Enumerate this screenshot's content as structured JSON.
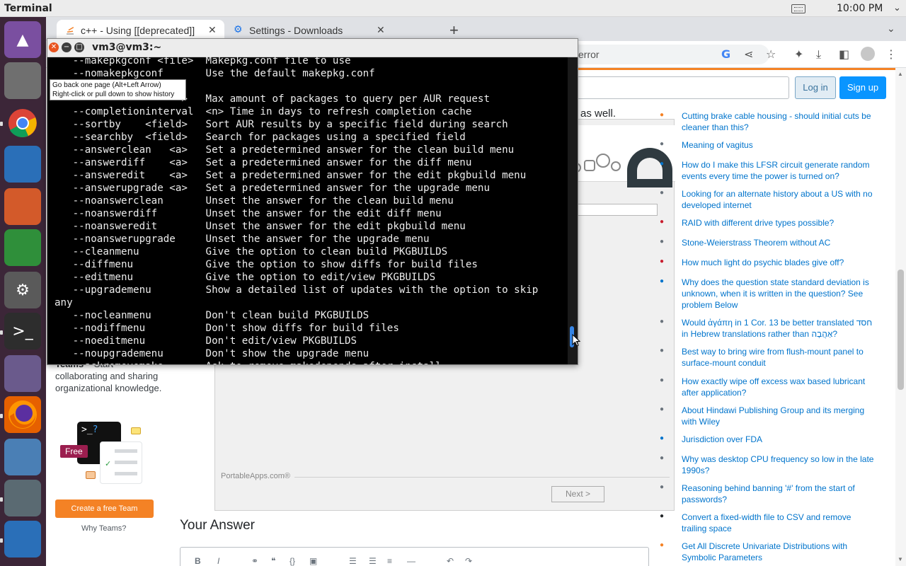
{
  "topbar": {
    "app_name": "Terminal",
    "time": "10:00 PM"
  },
  "dock": {
    "items": [
      {
        "name": "arch-launcher-icon",
        "glyph": "▲",
        "color": "#7a4fa0"
      },
      {
        "name": "files-icon",
        "glyph": "",
        "color": "#6f6f6f"
      },
      {
        "name": "chrome-icon",
        "glyph": "",
        "color": "#3c2638"
      },
      {
        "name": "writer-icon",
        "glyph": "",
        "color": "#2a6fb8"
      },
      {
        "name": "impress-icon",
        "glyph": "",
        "color": "#d35a2a"
      },
      {
        "name": "calc-icon",
        "glyph": "",
        "color": "#2f8f3a"
      },
      {
        "name": "settings-icon",
        "glyph": "⚙",
        "color": "#5a5a5a"
      },
      {
        "name": "terminal-icon",
        "glyph": ">_",
        "color": "#2d2d2d"
      },
      {
        "name": "folder-icon",
        "glyph": "",
        "color": "#6a5a8c"
      },
      {
        "name": "firefox-icon",
        "glyph": "",
        "color": "#e66000"
      },
      {
        "name": "disk-utility-icon",
        "glyph": "",
        "color": "#4a7fb5"
      },
      {
        "name": "portableapps-icon",
        "glyph": "",
        "color": "#5a6a72"
      },
      {
        "name": "update-icon",
        "glyph": "",
        "color": "#2a6fb8"
      }
    ]
  },
  "browser": {
    "tabs": [
      {
        "title": "c++ - Using [[deprecated]]",
        "active": true
      },
      {
        "title": "Settings - Downloads",
        "active": false
      }
    ],
    "omnibox_text": "error"
  },
  "page": {
    "login_label": "Log in",
    "signup_label": "Sign up",
    "as_well": "as well.",
    "teams_title": "Teams",
    "teams_text": " – Start collaborating and sharing organizational knowledge.",
    "free_label": "Free",
    "create_team_label": "Create a free Team",
    "why_teams_label": "Why Teams?",
    "your_answer": "Your Answer"
  },
  "dialog": {
    "brand": "PortableApps.com®",
    "next_label": "Next >"
  },
  "related": [
    "Cutting brake cable housing - should initial cuts be cleaner than this?",
    "Meaning of vagitus",
    "How do I make this LFSR circuit generate random events every time the power is turned on?",
    "Looking for an alternate history about a US with no developed internet",
    "RAID with different drive types possible?",
    "Stone-Weierstrass Theorem without AC",
    "How much light do psychic blades give off?",
    "Why does the question state standard deviation is unknown, when it is written in the question? See problem Below",
    "Would ἀγάπη in 1 Cor. 13 be better translated חסד in Hebrew translations rather than אַהֲבָה?",
    "Best way to bring wire from flush-mount panel to surface-mount conduit",
    "How exactly wipe off excess wax based lubricant after application?",
    "About Hindawi Publishing Group and its merging with Wiley",
    "Jurisdiction over FDA",
    "Why was desktop CPU frequency so low in the late 1990s?",
    "Reasoning behind banning '#' from the start of passwords?",
    "Convert a fixed-width file to CSV and remove trailing space",
    "Get All Discrete Univariate Distributions with Symbolic Parameters"
  ],
  "terminal": {
    "title": "vm3@vm3:~",
    "lines": [
      "   --makepkgconf <file>  Makepkg.conf file to use",
      "   --nomakepkgconf       Use the default makepkg.conf",
      "",
      "                     >   Max amount of packages to query per AUR request",
      "   --completioninterval  <n> Time in days to refresh completion cache",
      "   --sortby    <field>   Sort AUR results by a specific field during search",
      "   --searchby  <field>   Search for packages using a specified field",
      "   --answerclean   <a>   Set a predetermined answer for the clean build menu",
      "   --answerdiff    <a>   Set a predetermined answer for the diff menu",
      "   --answeredit    <a>   Set a predetermined answer for the edit pkgbuild menu",
      "   --answerupgrade <a>   Set a predetermined answer for the upgrade menu",
      "   --noanswerclean       Unset the answer for the clean build menu",
      "   --noanswerdiff        Unset the answer for the edit diff menu",
      "   --noansweredit        Unset the answer for the edit pkgbuild menu",
      "   --noanswerupgrade     Unset the answer for the upgrade menu",
      "   --cleanmenu           Give the option to clean build PKGBUILDS",
      "   --diffmenu            Give the option to show diffs for build files",
      "   --editmenu            Give the option to edit/view PKGBUILDS",
      "   --upgrademenu         Show a detailed list of updates with the option to skip",
      "any",
      "   --nocleanmenu         Don't clean build PKGBUILDS",
      "   --nodiffmenu          Don't show diffs for build files",
      "   --noeditmenu          Don't edit/view PKGBUILDS",
      "   --noupgrademenu       Don't show the upgrade menu",
      "   --askremovemake       Ask to remove makedepends after install"
    ],
    "tooltip": "Go back one page (Alt+Left Arrow)\nRight-click or pull down to show history"
  }
}
